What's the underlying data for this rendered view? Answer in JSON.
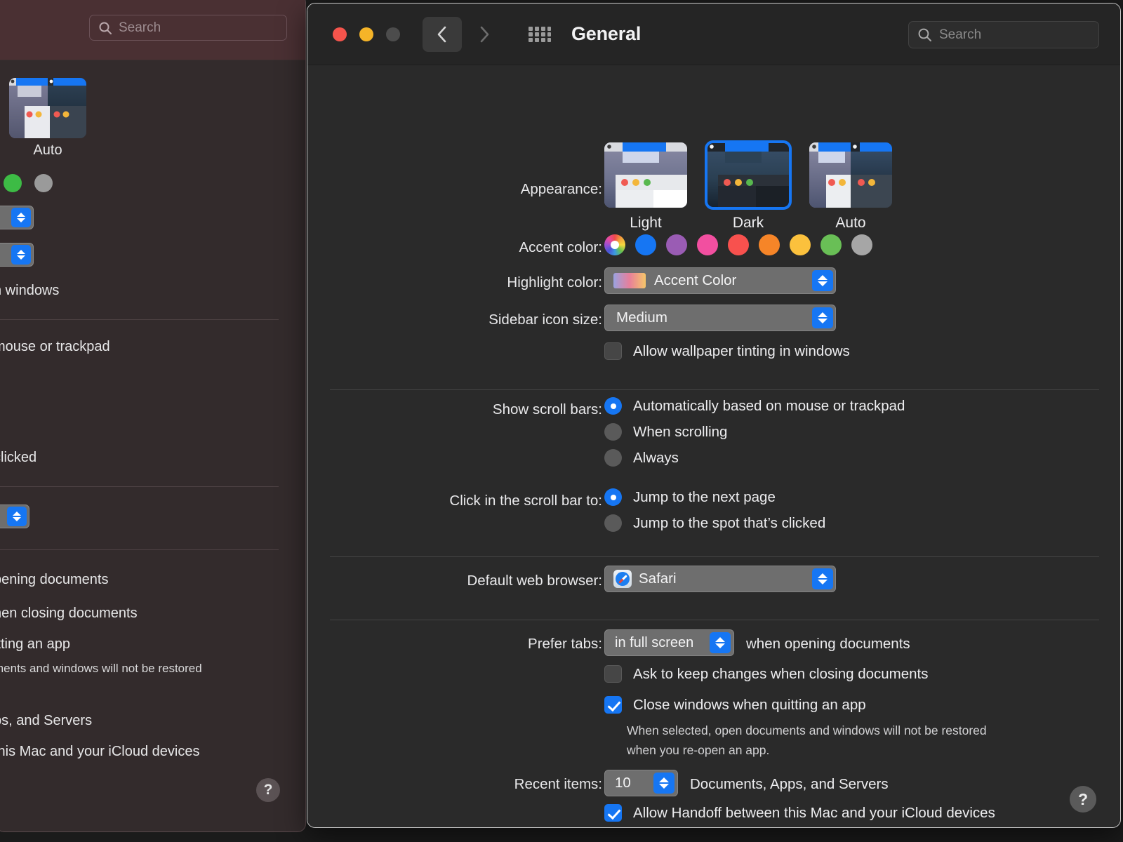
{
  "background_window": {
    "search": {
      "placeholder": "Search",
      "icon": "search-icon"
    },
    "appearance_thumb_label": "Auto",
    "swatch_colors": [
      "#3dbb45",
      "#9a9a9a"
    ],
    "clipped_texts": {
      "wallpaper_tinting": "n windows",
      "scroll_auto": "mouse or trackpad",
      "scroll_spot": "clicked",
      "prefer_tabs": "pening documents",
      "ask_keep": "hen closing documents",
      "close_windows": "itting an app",
      "close_windows_note": "ments and windows will not be restored",
      "recent_items": "ps, and Servers",
      "handoff": "this Mac and your iCloud devices"
    },
    "help_label": "?",
    "toolbar_tint": "#4a3033"
  },
  "window": {
    "title": "General",
    "traffic_lights": [
      {
        "name": "close",
        "color": "#f5544c"
      },
      {
        "name": "minimize",
        "color": "#f5b428"
      },
      {
        "name": "zoom",
        "color": "#4c4c4c"
      }
    ],
    "nav": {
      "back_icon": "chevron-left-icon",
      "forward_icon": "chevron-right-icon"
    },
    "grid_icon": "grid-icon",
    "search": {
      "placeholder": "Search",
      "icon": "search-icon"
    },
    "help_label": "?"
  },
  "appearance": {
    "label": "Appearance:",
    "options": [
      {
        "name": "Light",
        "selected": false
      },
      {
        "name": "Dark",
        "selected": true
      },
      {
        "name": "Auto",
        "selected": false
      }
    ]
  },
  "accent_color": {
    "label": "Accent color:",
    "swatches": [
      {
        "name": "multicolor",
        "color": "multi",
        "selected": true
      },
      {
        "name": "blue",
        "color": "#1676f3"
      },
      {
        "name": "purple",
        "color": "#9a5cb4"
      },
      {
        "name": "pink",
        "color": "#f24fa0"
      },
      {
        "name": "red",
        "color": "#f8514e"
      },
      {
        "name": "orange",
        "color": "#f68528"
      },
      {
        "name": "yellow",
        "color": "#fbc13d"
      },
      {
        "name": "green",
        "color": "#69bf56"
      },
      {
        "name": "graphite",
        "color": "#a6a6a6"
      }
    ]
  },
  "highlight_color": {
    "label": "Highlight color:",
    "value": "Accent Color"
  },
  "sidebar_icon_size": {
    "label": "Sidebar icon size:",
    "value": "Medium"
  },
  "wallpaper_tinting": {
    "label": "Allow wallpaper tinting in windows",
    "checked": false
  },
  "show_scroll_bars": {
    "label": "Show scroll bars:",
    "options": [
      {
        "label": "Automatically based on mouse or trackpad",
        "selected": true
      },
      {
        "label": "When scrolling",
        "selected": false
      },
      {
        "label": "Always",
        "selected": false
      }
    ]
  },
  "click_scroll_bar": {
    "label": "Click in the scroll bar to:",
    "options": [
      {
        "label": "Jump to the next page",
        "selected": true
      },
      {
        "label": "Jump to the spot that’s clicked",
        "selected": false
      }
    ]
  },
  "default_browser": {
    "label": "Default web browser:",
    "value": "Safari",
    "icon": "safari-icon"
  },
  "prefer_tabs": {
    "label": "Prefer tabs:",
    "value": "in full screen",
    "suffix": "when opening documents"
  },
  "ask_keep_changes": {
    "label": "Ask to keep changes when closing documents",
    "checked": false
  },
  "close_windows": {
    "label": "Close windows when quitting an app",
    "checked": true,
    "note_line1": "When selected, open documents and windows will not be restored",
    "note_line2": "when you re-open an app."
  },
  "recent_items": {
    "label": "Recent items:",
    "value": "10",
    "suffix": "Documents, Apps, and Servers"
  },
  "handoff": {
    "label": "Allow Handoff between this Mac and your iCloud devices",
    "checked": true
  }
}
